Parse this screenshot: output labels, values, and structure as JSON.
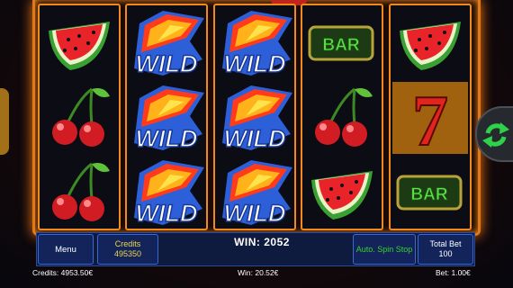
{
  "game": {
    "reels": [
      [
        "watermelon",
        "cherries",
        "cherries"
      ],
      [
        "wild",
        "wild",
        "wild"
      ],
      [
        "wild",
        "wild",
        "wild"
      ],
      [
        "bar",
        "cherries",
        "watermelon"
      ],
      [
        "watermelon",
        "seven",
        "bar"
      ]
    ],
    "wild_text": "WILD",
    "bar_text": "BAR",
    "seven_text": "7"
  },
  "controls": {
    "menu_label": "Menu",
    "credits_label": "Credits",
    "credits_value": "495350",
    "win_text": "WIN: 2052",
    "auto_spin_label": "Auto. Spin Stop",
    "total_bet_label": "Total Bet",
    "total_bet_value": "100",
    "spin_icon": "spin-arrows-icon"
  },
  "status_bar": {
    "credits": "Credits: 4953.50€",
    "win": "Win: 20.52€",
    "bet": "Bet: 1.00€"
  },
  "colors": {
    "frame": "#e07a16",
    "panel": "#12245a",
    "auto_spin_text": "#39d12b",
    "credits_text": "#f2d648",
    "spin_arrows": "#2fd14a"
  }
}
